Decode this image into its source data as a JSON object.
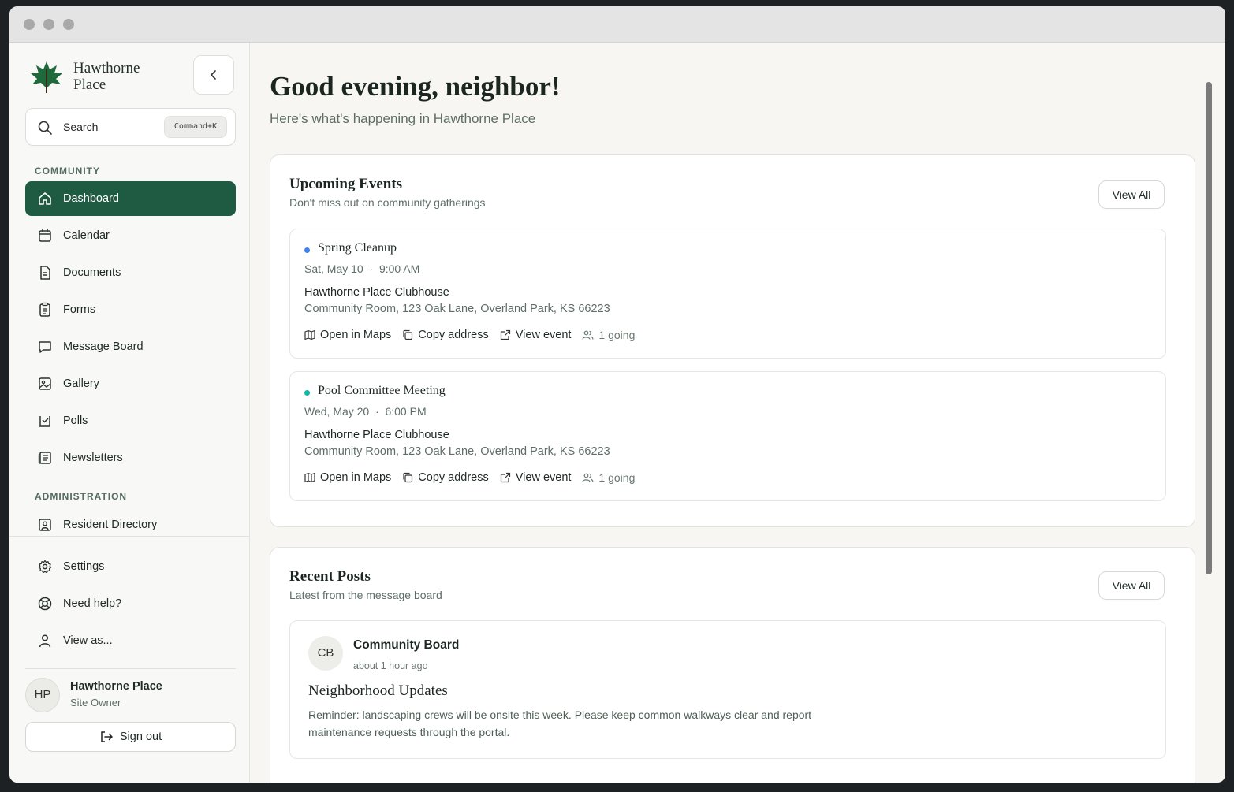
{
  "brand": {
    "name": "Hawthorne Place",
    "logo_icon": "leaf-icon",
    "accent": "#1f5a42"
  },
  "search": {
    "label": "Search",
    "shortcut": "Command+K"
  },
  "sidebar": {
    "community_label": "COMMUNITY",
    "items": [
      {
        "label": "Dashboard",
        "icon": "home-icon",
        "active": true
      },
      {
        "label": "Calendar",
        "icon": "calendar-icon"
      },
      {
        "label": "Documents",
        "icon": "document-icon"
      },
      {
        "label": "Forms",
        "icon": "clipboard-icon"
      },
      {
        "label": "Message Board",
        "icon": "message-icon"
      },
      {
        "label": "Gallery",
        "icon": "image-icon"
      },
      {
        "label": "Polls",
        "icon": "poll-icon"
      },
      {
        "label": "Newsletters",
        "icon": "newspaper-icon"
      }
    ],
    "admin_label": "ADMINISTRATION",
    "admin_items": [
      {
        "label": "Resident Directory",
        "icon": "contact-icon"
      }
    ],
    "footer_items": [
      {
        "label": "Settings",
        "icon": "gear-icon"
      },
      {
        "label": "Need help?",
        "icon": "lifebuoy-icon"
      },
      {
        "label": "View as...",
        "icon": "user-icon"
      }
    ],
    "user": {
      "initials": "HP",
      "name": "Hawthorne Place",
      "role": "Site Owner"
    },
    "sign_out": "Sign out"
  },
  "main": {
    "greeting": "Good evening, neighbor!",
    "subgreeting": "Here's what's happening in Hawthorne Place",
    "events_card": {
      "title": "Upcoming Events",
      "subtitle": "Don't miss out on community gatherings",
      "view_all": "View All",
      "events": [
        {
          "title": "Spring Cleanup",
          "dot_color": "#3b82f6",
          "date": "Sat, May 10",
          "time": "9:00 AM",
          "place": "Hawthorne Place Clubhouse",
          "address": "Community Room, 123 Oak Lane, Overland Park, KS 66223",
          "actions": {
            "maps": "Open in Maps",
            "copy": "Copy address",
            "view": "View event",
            "going": "1 going"
          }
        },
        {
          "title": "Pool Committee Meeting",
          "dot_color": "#14b8a6",
          "date": "Wed, May 20",
          "time": "6:00 PM",
          "place": "Hawthorne Place Clubhouse",
          "address": "Community Room, 123 Oak Lane, Overland Park, KS 66223",
          "actions": {
            "maps": "Open in Maps",
            "copy": "Copy address",
            "view": "View event",
            "going": "1 going"
          }
        }
      ]
    },
    "posts_card": {
      "title": "Recent Posts",
      "subtitle": "Latest from the message board",
      "view_all": "View All",
      "post": {
        "initials": "CB",
        "author": "Community Board",
        "time": "about 1 hour ago",
        "title": "Neighborhood Updates",
        "body": "Reminder: landscaping crews will be onsite this week. Please keep common walkways clear and report maintenance requests through the portal."
      }
    }
  }
}
